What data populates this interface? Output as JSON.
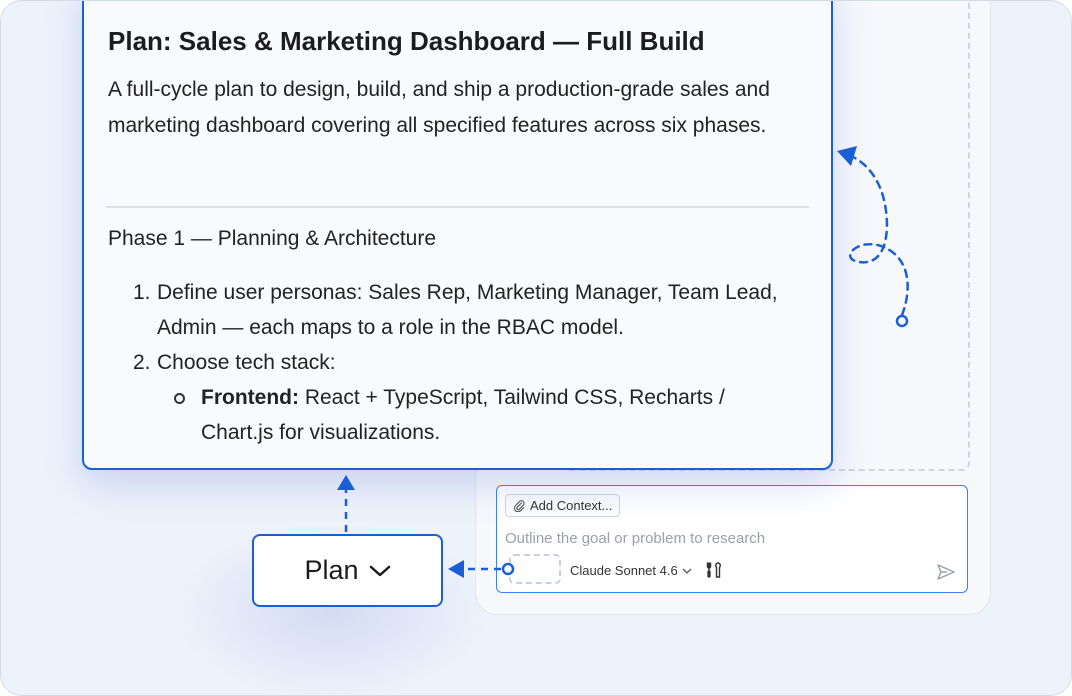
{
  "plan": {
    "title": "Plan: Sales & Marketing Dashboard — Full Build",
    "description": "A full-cycle plan to design, build, and ship a production-grade sales and marketing dashboard covering all specified features across six phases.",
    "phase_heading": "Phase 1 — Planning & Architecture",
    "steps": [
      {
        "number": "1.",
        "text": "Define user personas: Sales Rep, Marketing Manager, Team Lead, Admin — each maps to a role in the RBAC model."
      },
      {
        "number": "2.",
        "text": "Choose tech stack:"
      }
    ],
    "substeps": [
      {
        "label": "Frontend:",
        "text": " React + TypeScript, Tailwind CSS, Recharts / Chart.js for visualizations."
      }
    ]
  },
  "mode_button": {
    "label": "Plan",
    "icon": "chevron-down-icon"
  },
  "chat_input": {
    "context_chip": "Add Context...",
    "placeholder": "Outline the goal or problem to research",
    "model": "Claude Sonnet 4.6",
    "icons": [
      "paperclip-icon",
      "chevron-down-icon",
      "tools-icon",
      "send-icon"
    ]
  },
  "colors": {
    "accent": "#1a5fd6",
    "input_border": "#3b82f6",
    "background": "#eef2fb"
  }
}
